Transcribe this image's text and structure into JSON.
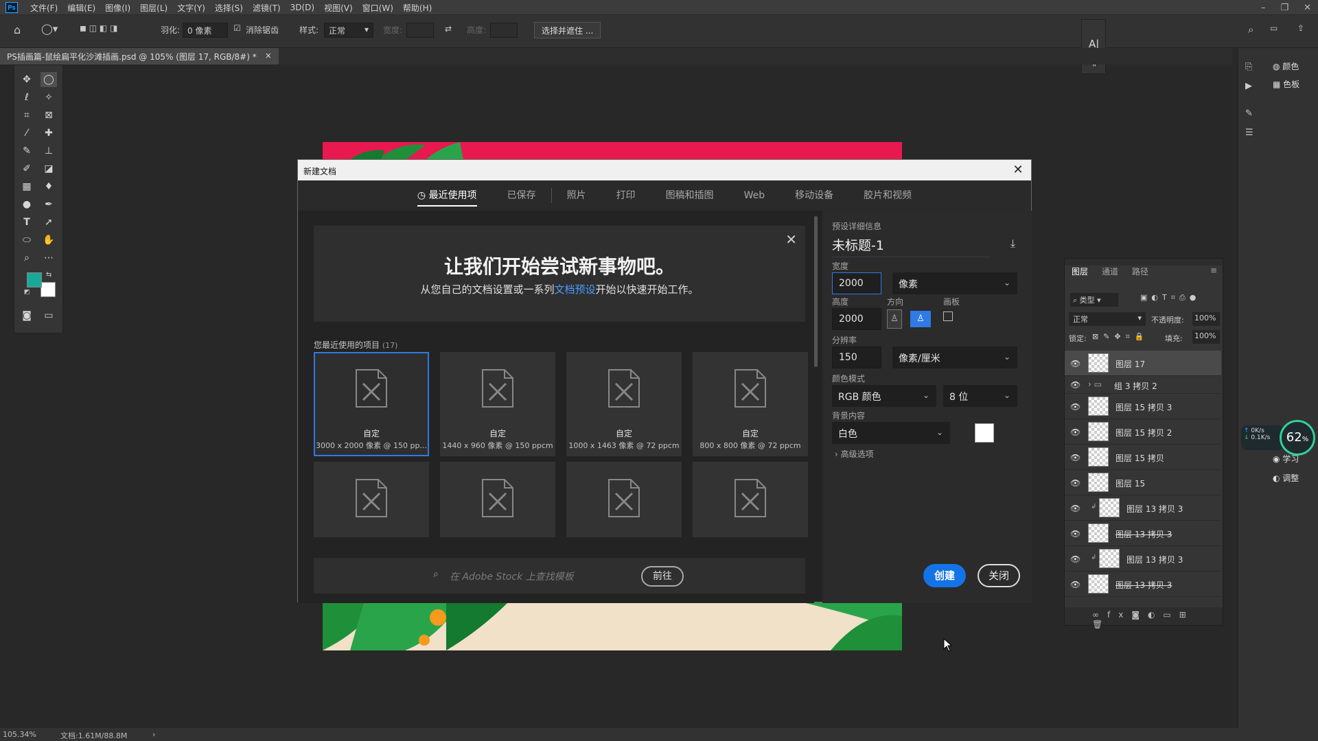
{
  "app": {
    "logo": "Ps",
    "menus": [
      "文件(F)",
      "编辑(E)",
      "图像(I)",
      "图层(L)",
      "文字(Y)",
      "选择(S)",
      "滤镜(T)",
      "3D(D)",
      "视图(V)",
      "窗口(W)",
      "帮助(H)"
    ]
  },
  "options_bar": {
    "feather_label": "羽化:",
    "feather_value": "0 像素",
    "antialias_label": "消除锯齿",
    "style_label": "样式:",
    "style_value": "正常",
    "width_label": "宽度:",
    "height_label": "高度:",
    "select_mask_button": "选择并遮住 ..."
  },
  "document_tab": {
    "title": "PS插画篇-鼠绘扁平化沙滩插画.psd @ 105% (图层 17, RGB/8#) *",
    "close": "×"
  },
  "dialog": {
    "title": "新建文档",
    "tabs": [
      "最近使用项",
      "已保存",
      "照片",
      "打印",
      "图稿和插图",
      "Web",
      "移动设备",
      "胶片和视频"
    ],
    "active_tab": 0,
    "welcome_title": "让我们开始尝试新事物吧。",
    "welcome_sub_before": "从您自己的文档设置或一系列",
    "welcome_sub_link": "文档预设",
    "welcome_sub_after": "开始以快速开始工作。",
    "recent_label": "您最近使用的项目",
    "recent_count": "(17)",
    "recent_items": [
      {
        "name": "自定",
        "dims": "3000 x 2000 像素 @ 150 pp..."
      },
      {
        "name": "自定",
        "dims": "1440 x 960 像素 @ 150 ppcm"
      },
      {
        "name": "自定",
        "dims": "1000 x 1463 像素 @ 72 ppcm"
      },
      {
        "name": "自定",
        "dims": "800 x 800 像素 @ 72 ppcm"
      }
    ],
    "stock_placeholder": "在 Adobe Stock 上查找模板",
    "stock_button": "前往",
    "preset_details_label": "预设详细信息",
    "doc_name": "未标题-1",
    "width_label": "宽度",
    "width_value": "2000",
    "width_unit": "像素",
    "height_label": "高度",
    "height_value": "2000",
    "orientation_label": "方向",
    "artboard_label": "画板",
    "resolution_label": "分辨率",
    "resolution_value": "150",
    "resolution_unit": "像素/厘米",
    "color_mode_label": "颜色模式",
    "color_mode_value": "RGB 颜色",
    "bit_depth_value": "8 位",
    "background_label": "背景内容",
    "background_value": "白色",
    "advanced_label": "高级选项",
    "create_button": "创建",
    "close_button": "关闭"
  },
  "layers_panel": {
    "tabs": [
      "图层",
      "通道",
      "路径"
    ],
    "filter_value": "类型",
    "blend_mode": "正常",
    "opacity_label": "不透明度:",
    "opacity_value": "100%",
    "lock_label": "锁定:",
    "fill_label": "填充:",
    "fill_value": "100%",
    "layers": [
      {
        "name": "图层 17",
        "type": "layer",
        "selected": true
      },
      {
        "name": "组 3 拷贝 2",
        "type": "group"
      },
      {
        "name": "图层 15 拷贝 3",
        "type": "layer"
      },
      {
        "name": "图层 15 拷贝 2",
        "type": "layer"
      },
      {
        "name": "图层 15 拷贝",
        "type": "layer"
      },
      {
        "name": "图层 15",
        "type": "layer"
      },
      {
        "name": "图层 13 拷贝 3",
        "type": "clipped"
      },
      {
        "name": "图层 13 拷贝 3",
        "type": "layer"
      },
      {
        "name": "图层 13 拷贝 3",
        "type": "clipped"
      },
      {
        "name": "图层 13 拷贝 3",
        "type": "layer"
      }
    ]
  },
  "right_strip": {
    "color_label": "颜色",
    "swatches_label": "色板",
    "learn_label": "学习",
    "adjust_label": "调整"
  },
  "net_widget": {
    "percent": "62",
    "up": "0",
    "down": "0.1",
    "unit": "K/s"
  },
  "status": {
    "zoom": "105.34%",
    "doc": "文档:1.61M/88.8M"
  },
  "colors": {
    "foreground": "#1aa89a",
    "background": "#ffffff",
    "accent": "#1473e6"
  }
}
